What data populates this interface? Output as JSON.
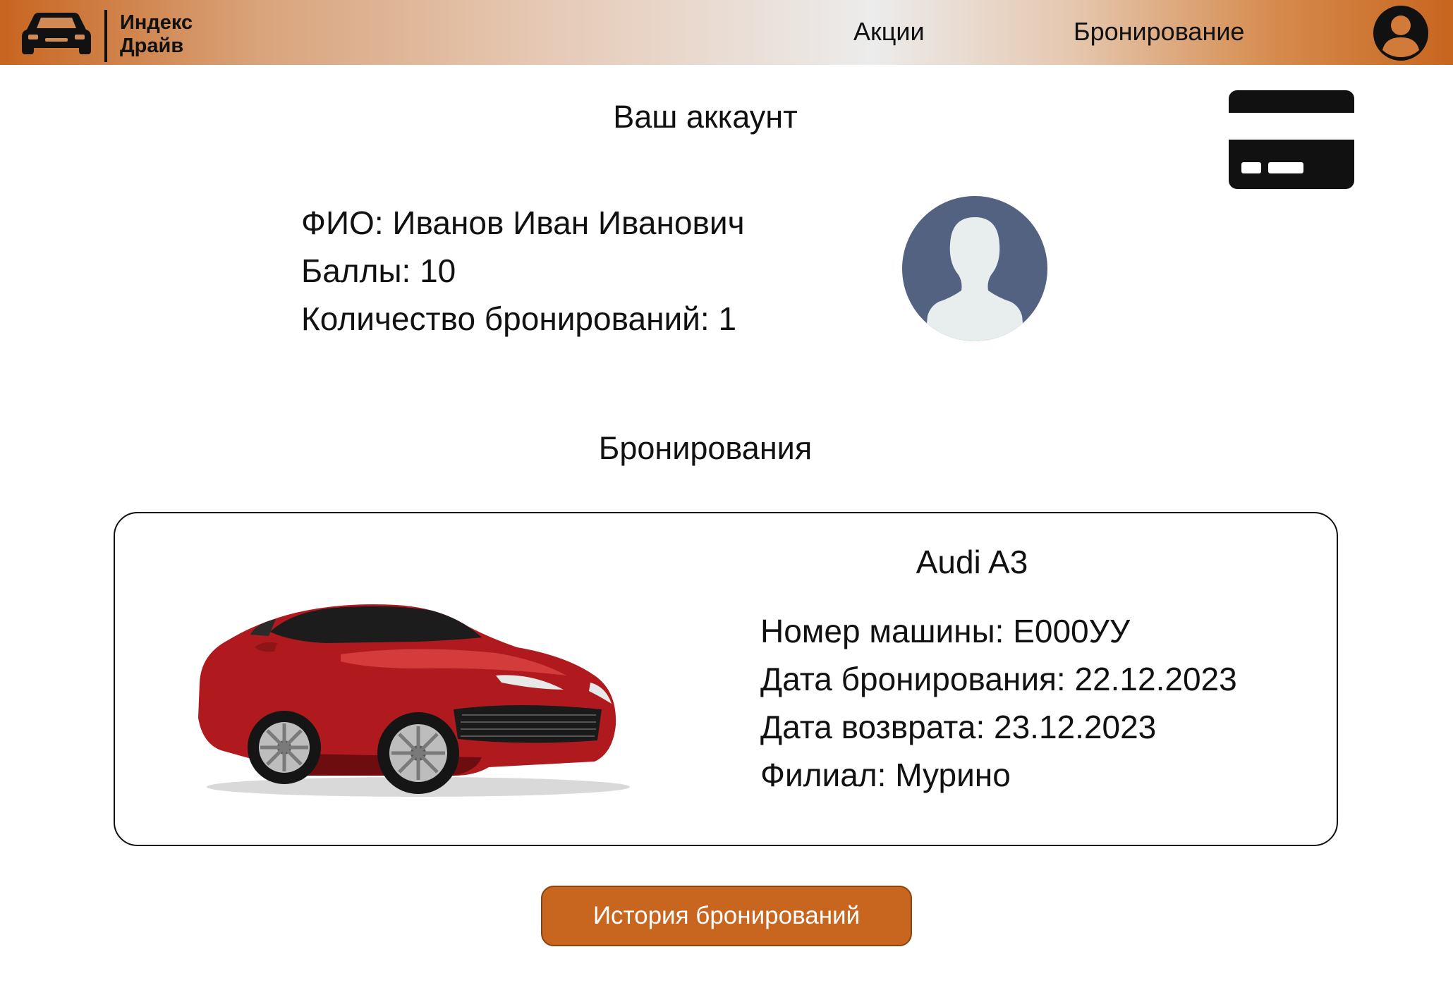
{
  "header": {
    "logo_line1": "Индекс",
    "logo_line2": "Драйв",
    "logo_icon": "car-icon",
    "nav": [
      "Акции",
      "Бронирование"
    ],
    "user_icon": "user-account-icon"
  },
  "card_icon": "credit-card-icon",
  "page_title": "Ваш аккаунт",
  "profile": {
    "name": "ФИО: Иванов Иван Иванович",
    "points": "Баллы: 10",
    "bookings_count": "Количество бронирований: 1",
    "avatar_icon": "avatar-placeholder-icon"
  },
  "bookings_title": "Бронирования",
  "booking": {
    "model": "Audi A3",
    "plate": "Номер машины: Е000УУ",
    "booking_date": "Дата бронирования: 22.12.2023",
    "return_date": "Дата возврата: 23.12.2023",
    "branch": "Филиал: Мурино",
    "image": "red-sports-car"
  },
  "history_button": "История бронирований",
  "colors": {
    "accent": "#c8651f",
    "avatar_bg": "#546282",
    "avatar_figure": "#e8eeee"
  }
}
